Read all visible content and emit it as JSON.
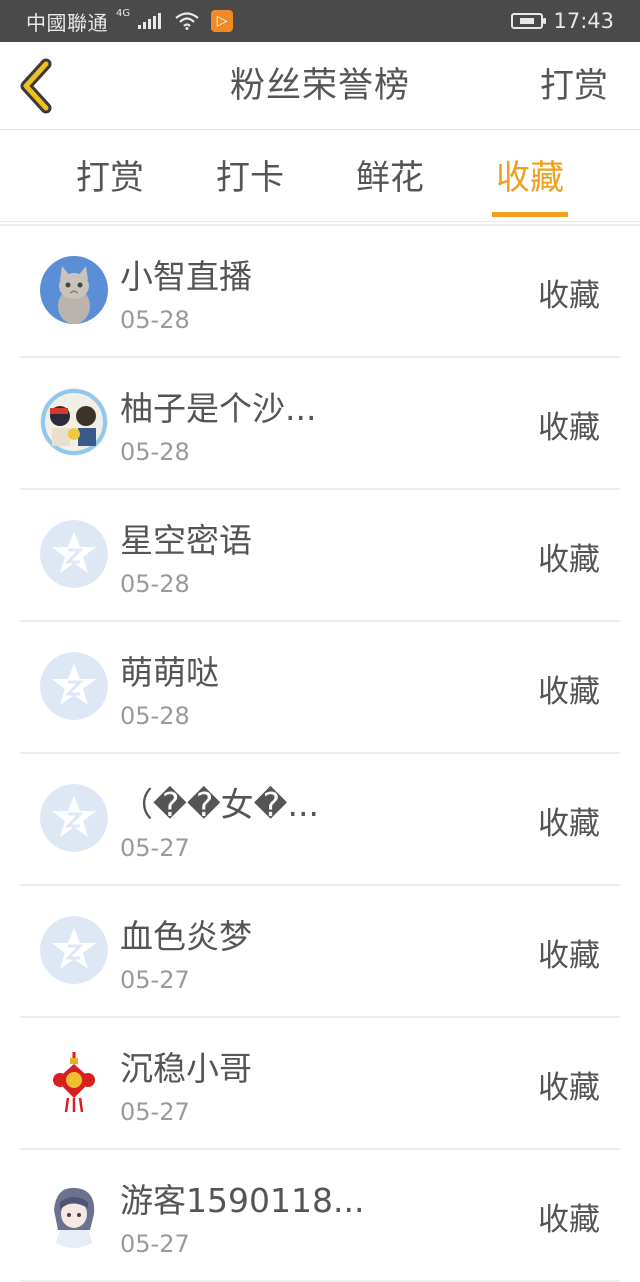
{
  "status_bar": {
    "carrier": "中國聯通",
    "network": "4G",
    "time": "17:43",
    "app_icon": "video-app-icon"
  },
  "header": {
    "back_icon": "chevron-left-icon",
    "title": "粉丝荣誉榜",
    "right_action": "打赏"
  },
  "tabs": [
    {
      "label": "打赏",
      "active": false
    },
    {
      "label": "打卡",
      "active": false
    },
    {
      "label": "鲜花",
      "active": false
    },
    {
      "label": "收藏",
      "active": true
    }
  ],
  "accent_color": "#f0a020",
  "list": [
    {
      "name": "小智直播",
      "date": "05-28",
      "action": "收藏",
      "avatar": "kitten-photo"
    },
    {
      "name": "柚子是个沙...",
      "date": "05-28",
      "action": "收藏",
      "avatar": "anime-characters"
    },
    {
      "name": "星空密语",
      "date": "05-28",
      "action": "收藏",
      "avatar": "default-star-avatar"
    },
    {
      "name": "萌萌哒",
      "date": "05-28",
      "action": "收藏",
      "avatar": "default-star-avatar"
    },
    {
      "name": "（��女�...",
      "date": "05-27",
      "action": "收藏",
      "avatar": "default-star-avatar"
    },
    {
      "name": "血色炎梦",
      "date": "05-27",
      "action": "收藏",
      "avatar": "default-star-avatar"
    },
    {
      "name": "沉稳小哥",
      "date": "05-27",
      "action": "收藏",
      "avatar": "chinese-knot"
    },
    {
      "name": "游客1590118...",
      "date": "05-27",
      "action": "收藏",
      "avatar": "anime-girl"
    }
  ]
}
